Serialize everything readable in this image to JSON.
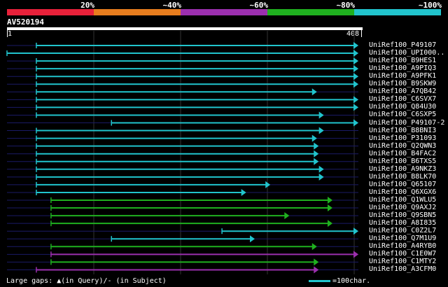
{
  "legend": {
    "labels": [
      "20%",
      "~40%",
      "~60%",
      "~80%",
      "~100%"
    ],
    "colors": [
      "#e8213a",
      "#e77d1e",
      "#9b2fae",
      "#1fb01f",
      "#21c4cd"
    ]
  },
  "query": {
    "id": "AV520194",
    "start": "1",
    "end": "408",
    "length": 408
  },
  "colors": {
    "cyan": "#21c4cd",
    "green": "#1fb01f",
    "purple": "#9b2fae",
    "dark": "#1a1a66"
  },
  "hits": [
    {
      "name": "UniRef100_P49107",
      "start": 35,
      "end": 408,
      "color": "cyan"
    },
    {
      "name": "UniRef100_UPI000..",
      "start": 1,
      "end": 408,
      "color": "cyan"
    },
    {
      "name": "UniRef100_B9HES1",
      "start": 35,
      "end": 408,
      "color": "cyan"
    },
    {
      "name": "UniRef100_A9PIQ3",
      "start": 35,
      "end": 408,
      "color": "cyan"
    },
    {
      "name": "UniRef100_A9PFK1",
      "start": 35,
      "end": 408,
      "color": "cyan"
    },
    {
      "name": "UniRef100_B9SKW9",
      "start": 35,
      "end": 408,
      "color": "cyan"
    },
    {
      "name": "UniRef100_A7QB42",
      "start": 35,
      "end": 360,
      "color": "cyan"
    },
    {
      "name": "UniRef100_C6SVX7",
      "start": 35,
      "end": 408,
      "color": "cyan"
    },
    {
      "name": "UniRef100_Q84U30",
      "start": 35,
      "end": 408,
      "color": "cyan"
    },
    {
      "name": "UniRef100_C6SXP5",
      "start": 35,
      "end": 368,
      "color": "cyan"
    },
    {
      "name": "UniRef100_P49107-2",
      "start": 122,
      "end": 408,
      "color": "cyan"
    },
    {
      "name": "UniRef100_B8BNI3",
      "start": 35,
      "end": 368,
      "color": "cyan"
    },
    {
      "name": "UniRef100_P31093",
      "start": 35,
      "end": 360,
      "color": "cyan"
    },
    {
      "name": "UniRef100_Q2QWN3",
      "start": 35,
      "end": 362,
      "color": "cyan"
    },
    {
      "name": "UniRef100_B4FAC2",
      "start": 35,
      "end": 362,
      "color": "cyan"
    },
    {
      "name": "UniRef100_B6TXS5",
      "start": 35,
      "end": 362,
      "color": "cyan"
    },
    {
      "name": "UniRef100_A9NKZ3",
      "start": 35,
      "end": 368,
      "color": "cyan"
    },
    {
      "name": "UniRef100_B8LK70",
      "start": 35,
      "end": 368,
      "color": "cyan"
    },
    {
      "name": "UniRef100_Q65107",
      "start": 35,
      "end": 306,
      "color": "cyan"
    },
    {
      "name": "UniRef100_Q6XGX6",
      "start": 35,
      "end": 278,
      "color": "cyan"
    },
    {
      "name": "UniRef100_Q1WLU5",
      "start": 52,
      "end": 378,
      "color": "green"
    },
    {
      "name": "UniRef100_Q9AXJ2",
      "start": 52,
      "end": 378,
      "color": "green"
    },
    {
      "name": "UniRef100_Q9SBN5",
      "start": 52,
      "end": 328,
      "color": "green"
    },
    {
      "name": "UniRef100_A8I835",
      "start": 52,
      "end": 378,
      "color": "green"
    },
    {
      "name": "UniRef100_C0Z2L7",
      "start": 250,
      "end": 408,
      "color": "cyan"
    },
    {
      "name": "UniRef100_Q7M1U9",
      "start": 122,
      "end": 288,
      "color": "cyan"
    },
    {
      "name": "UniRef100_A4RYB0",
      "start": 52,
      "end": 360,
      "color": "green"
    },
    {
      "name": "UniRef100_C1E0W7",
      "start": 52,
      "end": 408,
      "color": "purple"
    },
    {
      "name": "UniRef100_C1MTY2",
      "start": 52,
      "end": 362,
      "color": "green"
    },
    {
      "name": "UniRef100_A3CFM0",
      "start": 35,
      "end": 362,
      "color": "purple"
    }
  ],
  "footer": {
    "gaps_note": "Large gaps: ▲(in Query)/- (in Subject)",
    "scale_label": "=100char."
  }
}
